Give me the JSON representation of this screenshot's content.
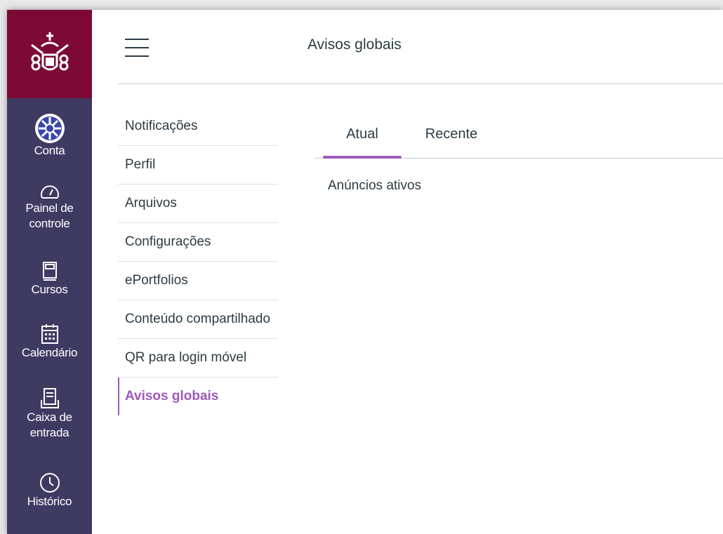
{
  "nav": {
    "items": [
      {
        "label_lines": [
          "Conta"
        ],
        "icon": "avatar-icon"
      },
      {
        "label_lines": [
          "Painel de",
          "controle"
        ],
        "icon": "dashboard-icon"
      },
      {
        "label_lines": [
          "Cursos"
        ],
        "icon": "courses-icon"
      },
      {
        "label_lines": [
          "Calendário"
        ],
        "icon": "calendar-icon"
      },
      {
        "label_lines": [
          "Caixa de",
          "entrada"
        ],
        "icon": "inbox-icon"
      },
      {
        "label_lines": [
          "Histórico"
        ],
        "icon": "history-icon"
      }
    ]
  },
  "header": {
    "title": "Avisos globais"
  },
  "subnav": {
    "items": [
      {
        "label": "Notificações",
        "active": false
      },
      {
        "label": "Perfil",
        "active": false
      },
      {
        "label": "Arquivos",
        "active": false
      },
      {
        "label": "Configurações",
        "active": false
      },
      {
        "label": "ePortfolios",
        "active": false
      },
      {
        "label": "Conteúdo compartilhado",
        "active": false
      },
      {
        "label": "QR para login móvel",
        "active": false
      },
      {
        "label": "Avisos globais",
        "active": true
      }
    ]
  },
  "tabs": [
    {
      "label": "Atual",
      "active": true
    },
    {
      "label": "Recente",
      "active": false
    }
  ],
  "content": {
    "section_label": "Anúncios ativos"
  },
  "colors": {
    "nav_bg": "#3e3a62",
    "logo_bg": "#7d0a35",
    "accent": "#9e58bd",
    "text": "#2d3b45"
  }
}
